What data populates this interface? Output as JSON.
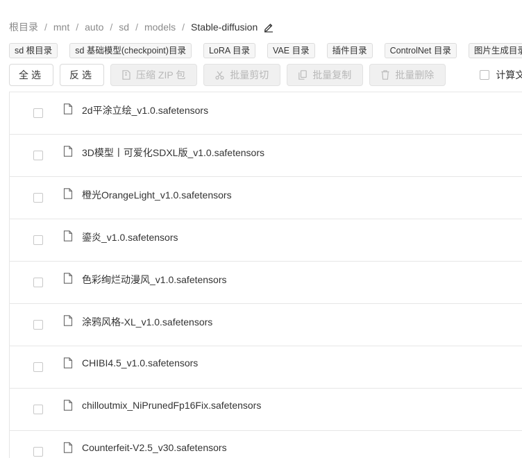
{
  "breadcrumb": [
    "根目录",
    "mnt",
    "auto",
    "sd",
    "models",
    "Stable-diffusion"
  ],
  "shortcuts": [
    "sd 根目录",
    "sd 基础模型(checkpoint)目录",
    "LoRA 目录",
    "VAE 目录",
    "插件目录",
    "ControlNet 目录",
    "图片生成目录"
  ],
  "toolbar": {
    "select_all": "全选",
    "invert": "反选",
    "zip": "压缩 ZIP 包",
    "cut": "批量剪切",
    "copy": "批量复制",
    "delete": "批量删除",
    "calc_label": "计算文件"
  },
  "files": [
    "2d平涂立绘_v1.0.safetensors",
    "3D模型丨可爱化SDXL版_v1.0.safetensors",
    "橙光OrangeLight_v1.0.safetensors",
    "鎏炎_v1.0.safetensors",
    "色彩绚烂动漫风_v1.0.safetensors",
    "涂鸦风格-XL_v1.0.safetensors",
    "CHIBI4.5_v1.0.safetensors",
    "chilloutmix_NiPrunedFp16Fix.safetensors",
    "Counterfeit-V2.5_v30.safetensors"
  ],
  "icons": {
    "edit": "pencil-icon",
    "zip": "archive-icon",
    "cut": "scissors-icon",
    "copy": "copy-icon",
    "delete": "trash-icon",
    "file": "file-icon"
  },
  "colors": {
    "border": "#e6e6e6",
    "disabled_text": "#b8b8b8",
    "breadcrumb_text": "#8a8a8a"
  }
}
